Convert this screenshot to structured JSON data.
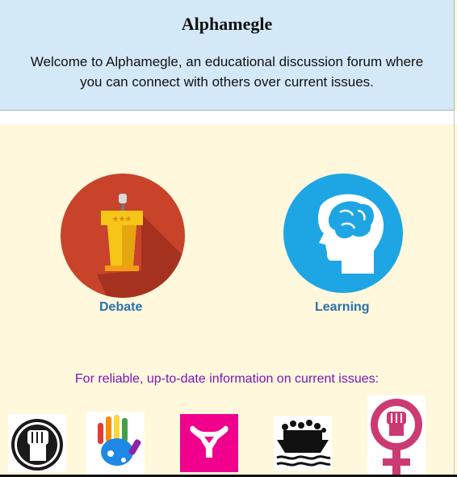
{
  "site": {
    "title": "Alphamegle",
    "welcome": "Welcome to Alphamegle, an educational discussion forum where you can connect with others over current issues."
  },
  "categories": [
    {
      "label": "Debate",
      "icon": "podium-icon",
      "color": "#c8432a"
    },
    {
      "label": "Learning",
      "icon": "brain-head-icon",
      "color": "#1da6e3"
    }
  ],
  "info": {
    "text": "For reliable, up-to-date information on current issues:"
  },
  "issue_icons": [
    "raised-fist-icon",
    "rainbow-hand-icon",
    "uterus-icon",
    "sinking-ship-icon",
    "feminist-fist-icon"
  ],
  "colors": {
    "header_bg": "#d4e9f7",
    "page_bg": "#fff8dc",
    "link": "#2a6fad",
    "info_text": "#7a16b8"
  }
}
